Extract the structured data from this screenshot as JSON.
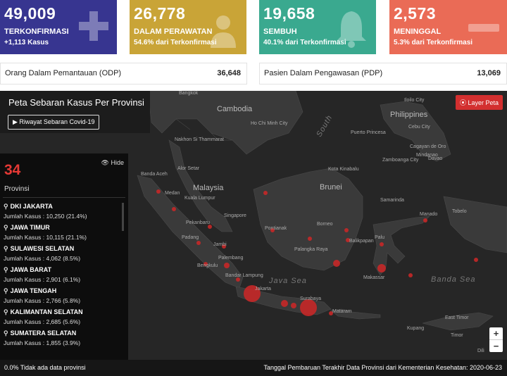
{
  "cards": [
    {
      "value": "49,009",
      "label": "TERKONFIRMASI",
      "sub": "+1,113 Kasus",
      "color": "#373590",
      "icon": "plus-icon"
    },
    {
      "value": "26,778",
      "label": "DALAM PERAWATAN",
      "sub": "54.6% dari Terkonfirmasi",
      "color": "#c9a437",
      "icon": "patient-icon"
    },
    {
      "value": "19,658",
      "label": "SEMBUH",
      "sub": "40.1% dari Terkonfirmasi",
      "color": "#3aa98f",
      "icon": "bell-icon"
    },
    {
      "value": "2,573",
      "label": "MENINGGAL",
      "sub": "5.3% dari Terkonfirmasi",
      "color": "#ea6b56",
      "icon": "minus-icon"
    }
  ],
  "odp": {
    "label": "Orang Dalam Pemantauan (ODP)",
    "value": "36,648"
  },
  "pdp": {
    "label": "Pasien Dalam Pengawasan (PDP)",
    "value": "13,069"
  },
  "map": {
    "title": "Peta Sebaran Kasus Per Provinsi",
    "history_button": "▶ Riwayat Sebaran Covid-19",
    "layer_button": "Layer Peta",
    "province_count": "34",
    "province_label": "Provinsi",
    "hide_label": "Hide",
    "provinces": [
      {
        "name": "DKI JAKARTA",
        "cases": "Jumlah Kasus : 10,250 (21.4%)"
      },
      {
        "name": "JAWA TIMUR",
        "cases": "Jumlah Kasus : 10,115 (21.1%)"
      },
      {
        "name": "SULAWESI SELATAN",
        "cases": "Jumlah Kasus : 4,062 (8.5%)"
      },
      {
        "name": "JAWA BARAT",
        "cases": "Jumlah Kasus : 2,901 (6.1%)"
      },
      {
        "name": "JAWA TENGAH",
        "cases": "Jumlah Kasus : 2,766 (5.8%)"
      },
      {
        "name": "KALIMANTAN SELATAN",
        "cases": "Jumlah Kasus : 2,685 (5.6%)"
      },
      {
        "name": "SUMATERA SELATAN",
        "cases": "Jumlah Kasus : 1,855 (3.9%)"
      }
    ],
    "labels": {
      "bangkok": "Bangkok",
      "cambodia": "Cambodia",
      "hochiminh": "Ho Chi Minh City",
      "nakhon": "Nakhon Si Thammarat",
      "southchina": "South",
      "philippines": "Philippines",
      "iloilo": "Iloilo City",
      "cebu": "Cebu City",
      "cagayan": "Cagayan de Oro",
      "davao": "Davao",
      "zamboanga": "Zamboanga City",
      "puerto": "Puerto Princesa",
      "bandaaceh": "Banda Aceh",
      "alorsetar": "Alor Setar",
      "malaysia": "Malaysia",
      "medan": "Medan",
      "kualalumpur": "Kuala Lumpur",
      "singapore": "Singapore",
      "kotakinabalu": "Kota Kinabalu",
      "brunei": "Brunei",
      "samarinda": "Samarinda",
      "pekanbaru": "Pekanbaru",
      "padang": "Padang",
      "jambi": "Jambi",
      "palembang": "Palembang",
      "bengkulu": "Bengkulu",
      "bandarlampung": "Bandar Lampung",
      "jakarta": "Jakarta",
      "surabaya": "Surabaya",
      "mataram": "Mataram",
      "pontianak": "Pontianak",
      "borneo": "Borneo",
      "palangka": "Palangka Raya",
      "balikpapan": "Balikpapan",
      "palu": "Palu",
      "makassar": "Makassar",
      "manado": "Manado",
      "tobelo": "Tobelo",
      "javasea": "Java Sea",
      "bandasea": "Banda Sea",
      "kupang": "Kupang",
      "timor": "Timor",
      "dili": "Dili",
      "east": "East Timor",
      "mindanao": "Mindanao"
    },
    "zoom_in": "+",
    "zoom_out": "−"
  },
  "footer": {
    "left": "0.0% Tidak ada data provinsi",
    "right": "Tanggal Pembaruan Terakhir Data Provinsi dari Kementerian Kesehatan: 2020-06-23"
  }
}
